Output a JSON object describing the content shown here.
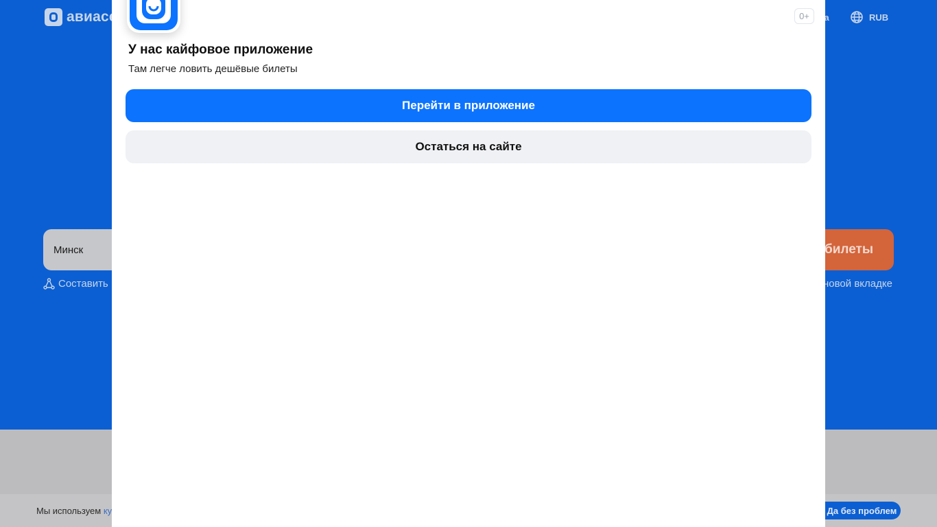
{
  "background": {
    "logo_text": "авиасе",
    "header_support": "ка",
    "header_currency": "RUB",
    "search_from_value": "Минск",
    "search_button_label": "билеты",
    "compose_route_label": "Составить",
    "new_tab_label": "новой вкладке",
    "cookie_text": "Мы используем ",
    "cookie_link": "ку",
    "cookie_accept_label": "Да без проблем"
  },
  "modal": {
    "age_rating": "0+",
    "title": "У нас кайфовое приложение",
    "subtitle": "Там легче ловить дешёвые билеты",
    "primary_button": "Перейти в приложение",
    "secondary_button": "Остаться на сайте"
  },
  "colors": {
    "brand_blue": "#0c73fe",
    "hero_blue": "#0c5fd2",
    "search_orange": "#d4643a"
  }
}
